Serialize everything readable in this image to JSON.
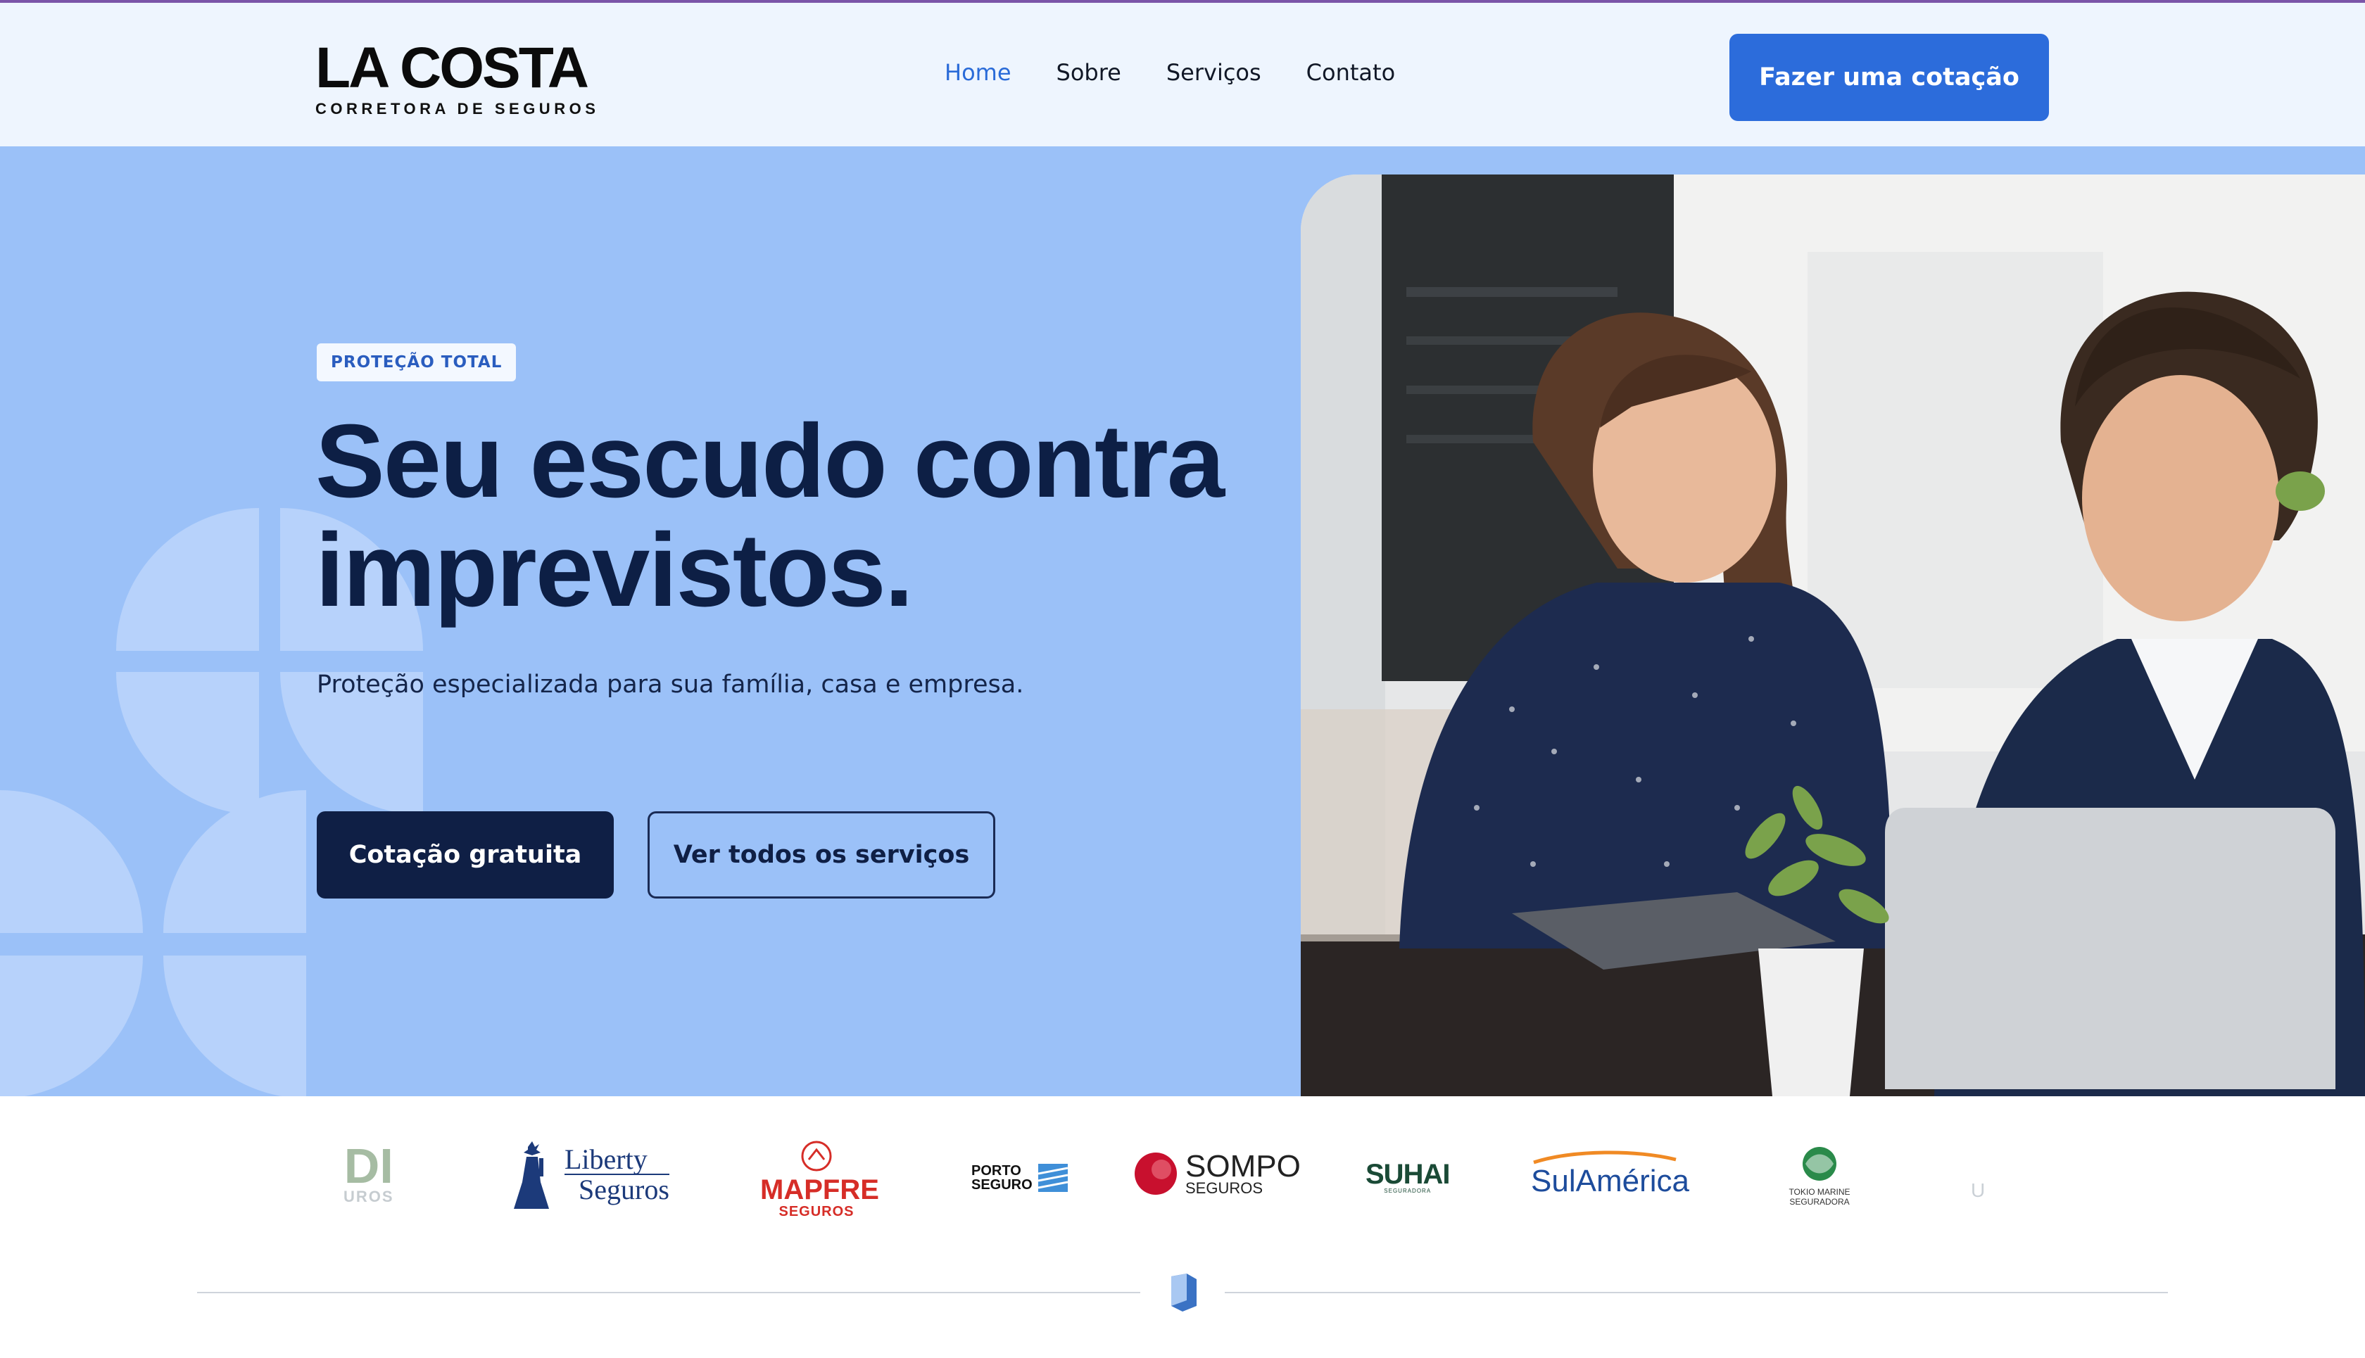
{
  "header": {
    "logo_main": "LA COSTA",
    "logo_sub": "CORRETORA DE SEGUROS",
    "nav": [
      {
        "label": "Home",
        "active": true
      },
      {
        "label": "Sobre",
        "active": false
      },
      {
        "label": "Serviços",
        "active": false
      },
      {
        "label": "Contato",
        "active": false
      }
    ],
    "cta_label": "Fazer uma cotação"
  },
  "hero": {
    "badge": "PROTEÇÃO TOTAL",
    "headline_line1": "Seu escudo contra",
    "headline_line2": "imprevistos.",
    "subtitle": "Proteção especializada para sua família, casa e empresa.",
    "primary_button": "Cotação gratuita",
    "secondary_button": "Ver todos os serviços",
    "image": "woman-and-man-reviewing-insurance-on-laptop"
  },
  "partners": {
    "logos": [
      {
        "name_line1": "DI",
        "name_line2": "UROS"
      },
      {
        "name_line1": "Liberty",
        "name_line2": "Seguros"
      },
      {
        "name_line1": "MAPFRE",
        "name_line2": "SEGUROS"
      },
      {
        "name_line1": "PORTO",
        "name_line2": "SEGURO"
      },
      {
        "name_line1": "SOMPO",
        "name_line2": "SEGUROS"
      },
      {
        "name_line1": "SUHAI",
        "name_line2": "SEGURADORA"
      },
      {
        "name_line1": "SulAmérica",
        "name_line2": ""
      },
      {
        "name_line1": "TOKIO MARINE",
        "name_line2": "SEGURADORA"
      },
      {
        "name_line1": "U",
        "name_line2": ""
      }
    ]
  },
  "colors": {
    "accent": "#2c6cdb",
    "navy": "#0f1f45",
    "hero_bg": "#9bc1f8",
    "header_bg": "#eef5fe"
  }
}
